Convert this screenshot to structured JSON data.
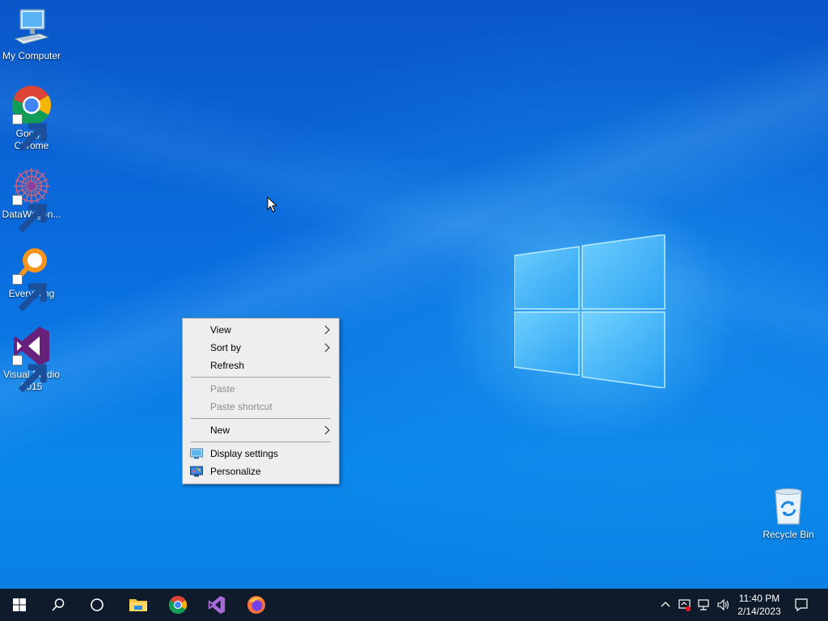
{
  "desktop": {
    "icons": [
      {
        "label": "My Computer",
        "icon": "monitor-icon"
      },
      {
        "label": "Google Chrome",
        "icon": "chrome-icon"
      },
      {
        "label": "DataWagon...",
        "icon": "datawagon-icon"
      },
      {
        "label": "Everything",
        "icon": "everything-search-icon"
      },
      {
        "label": "Visual Studio 2015",
        "icon": "visual-studio-icon"
      },
      {
        "label": "Recycle Bin",
        "icon": "recycle-bin-icon"
      }
    ]
  },
  "context_menu": {
    "items": [
      {
        "label": "View",
        "has_submenu": true,
        "enabled": true
      },
      {
        "label": "Sort by",
        "has_submenu": true,
        "enabled": true
      },
      {
        "label": "Refresh",
        "has_submenu": false,
        "enabled": true
      },
      {
        "label": "Paste",
        "has_submenu": false,
        "enabled": false
      },
      {
        "label": "Paste shortcut",
        "has_submenu": false,
        "enabled": false
      },
      {
        "label": "New",
        "has_submenu": true,
        "enabled": true
      },
      {
        "label": "Display settings",
        "has_submenu": false,
        "enabled": true,
        "icon": "display-settings-icon"
      },
      {
        "label": "Personalize",
        "has_submenu": false,
        "enabled": true,
        "icon": "personalize-icon"
      }
    ]
  },
  "taskbar": {
    "buttons": [
      "start-icon",
      "search-icon",
      "task-view-icon",
      "file-explorer-icon",
      "chrome-icon",
      "visual-studio-icon",
      "firefox-icon"
    ],
    "tray_icons": [
      "chevron-up-icon",
      "security-alert-icon",
      "network-icon",
      "volume-icon"
    ],
    "clock": {
      "time": "11:40 PM",
      "date": "2/14/2023"
    },
    "notifications_icon": "action-center-icon"
  },
  "colors": {
    "taskbar_bg": "#0f1b2a",
    "menu_bg": "#eeeeee",
    "desktop_blue": "#0a6fe0"
  }
}
